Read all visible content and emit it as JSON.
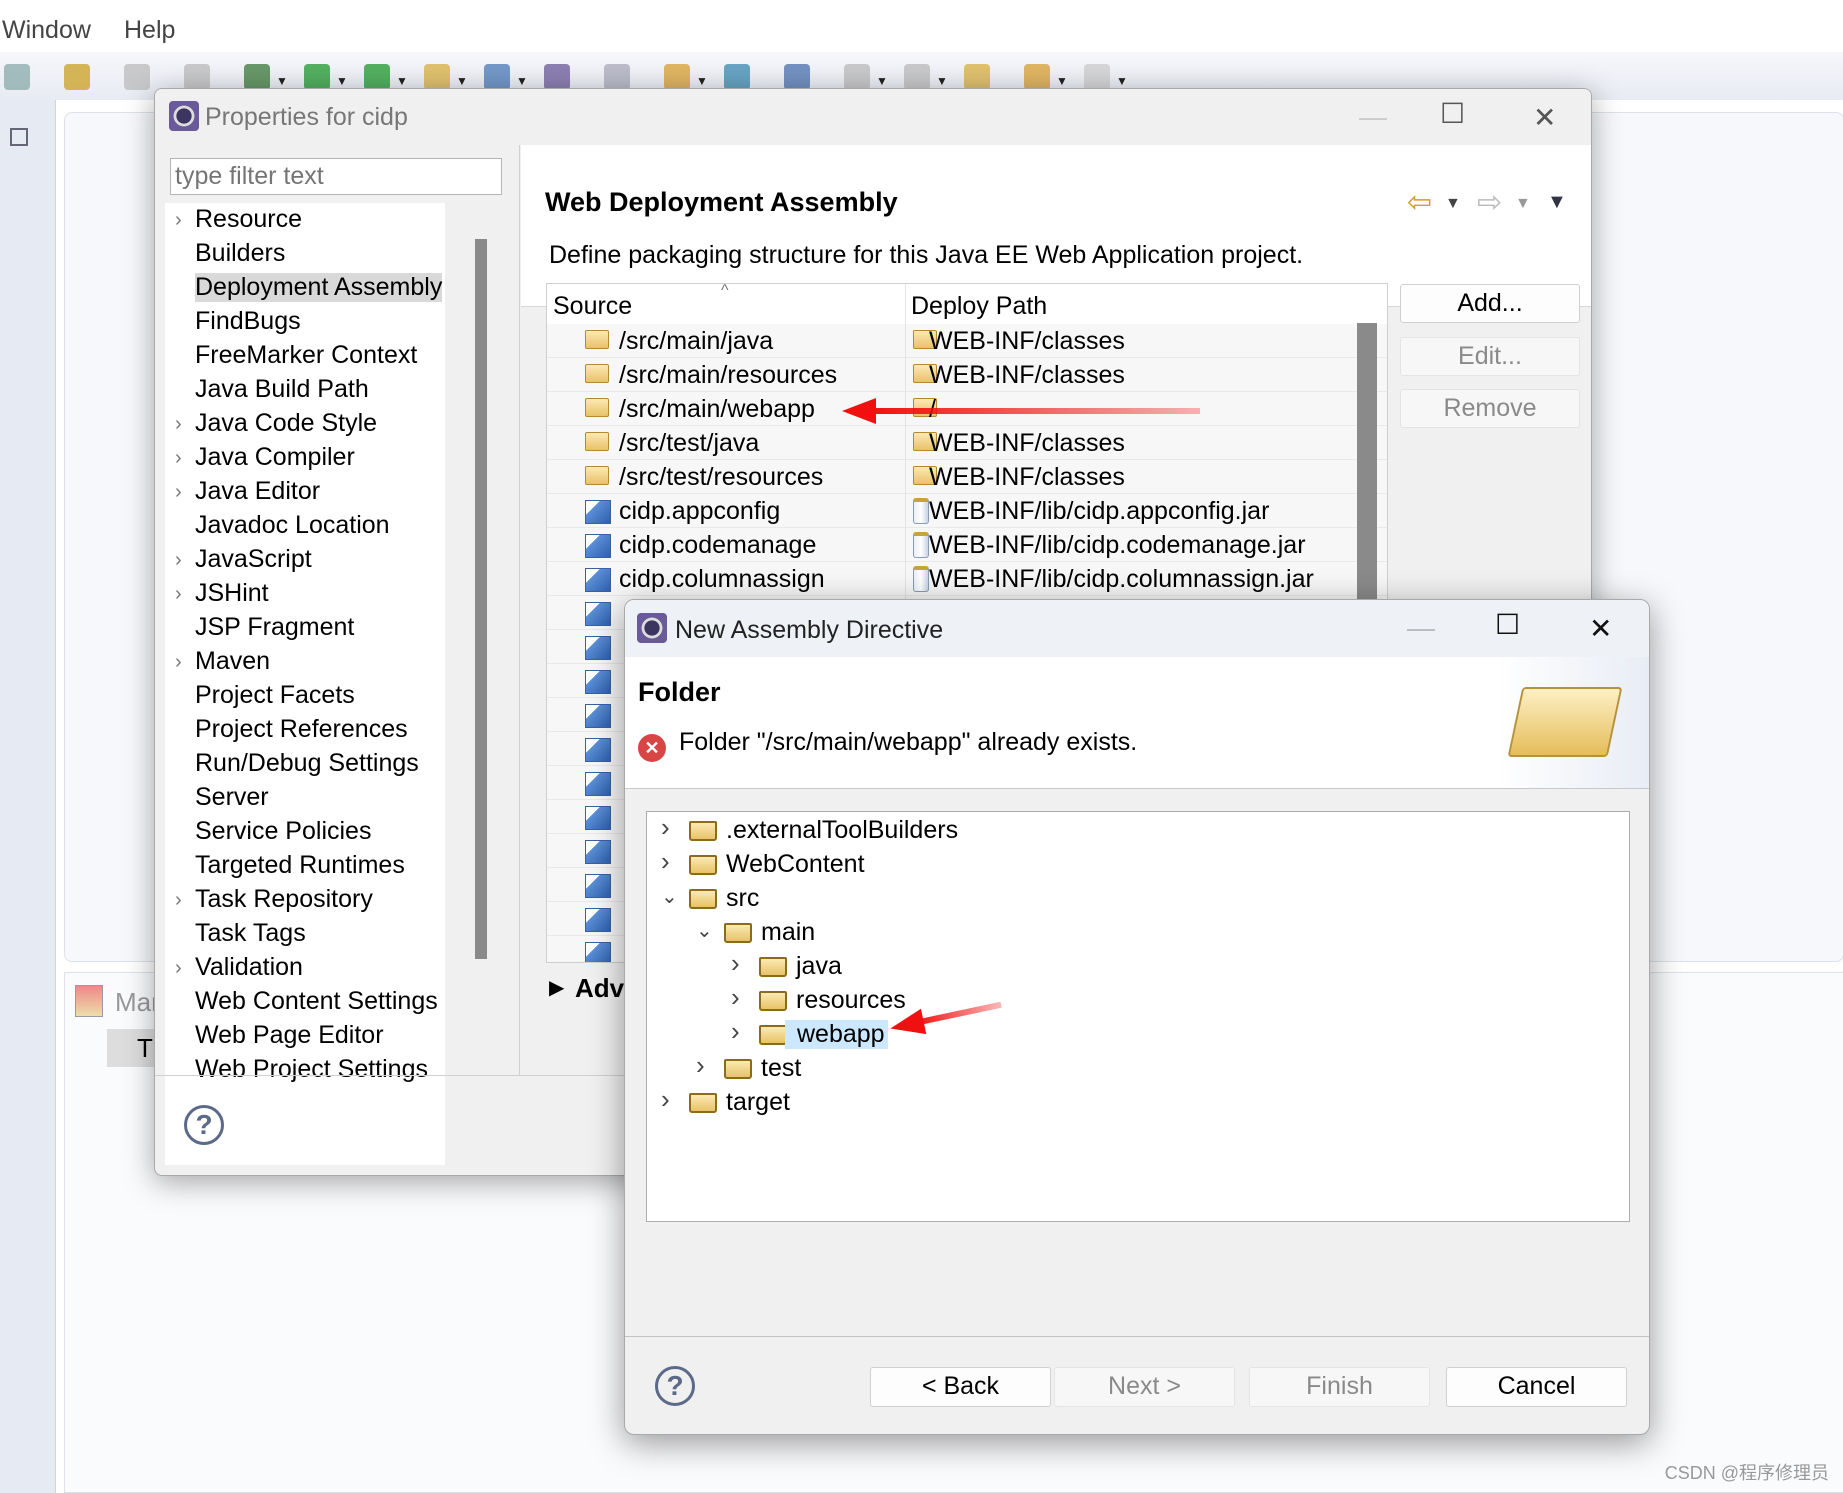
{
  "menubar": {
    "items": [
      "Window",
      "Help"
    ]
  },
  "workbench": {
    "panel_tab": "Mar",
    "panel_item": "T"
  },
  "properties": {
    "title": "Properties for cidp",
    "filter_placeholder": "type filter text",
    "nav": [
      {
        "label": "Resource",
        "expandable": true
      },
      {
        "label": "Builders",
        "expandable": false
      },
      {
        "label": "Deployment Assembly",
        "expandable": false,
        "selected": true
      },
      {
        "label": "FindBugs",
        "expandable": false
      },
      {
        "label": "FreeMarker Context",
        "expandable": false
      },
      {
        "label": "Java Build Path",
        "expandable": false
      },
      {
        "label": "Java Code Style",
        "expandable": true
      },
      {
        "label": "Java Compiler",
        "expandable": true
      },
      {
        "label": "Java Editor",
        "expandable": true
      },
      {
        "label": "Javadoc Location",
        "expandable": false
      },
      {
        "label": "JavaScript",
        "expandable": true
      },
      {
        "label": "JSHint",
        "expandable": true
      },
      {
        "label": "JSP Fragment",
        "expandable": false
      },
      {
        "label": "Maven",
        "expandable": true
      },
      {
        "label": "Project Facets",
        "expandable": false
      },
      {
        "label": "Project References",
        "expandable": false
      },
      {
        "label": "Run/Debug Settings",
        "expandable": false
      },
      {
        "label": "Server",
        "expandable": false
      },
      {
        "label": "Service Policies",
        "expandable": false
      },
      {
        "label": "Targeted Runtimes",
        "expandable": false
      },
      {
        "label": "Task Repository",
        "expandable": true
      },
      {
        "label": "Task Tags",
        "expandable": false
      },
      {
        "label": "Validation",
        "expandable": true
      },
      {
        "label": "Web Content Settings",
        "expandable": false
      },
      {
        "label": "Web Page Editor",
        "expandable": false
      },
      {
        "label": "Web Project Settings",
        "expandable": false
      }
    ],
    "page_title": "Web Deployment Assembly",
    "description": "Define packaging structure for this Java EE Web Application project.",
    "columns": [
      "Source",
      "Deploy Path"
    ],
    "rows": [
      {
        "source": "/src/main/java",
        "deploy": "WEB-INF/classes",
        "kind": "folder"
      },
      {
        "source": "/src/main/resources",
        "deploy": "WEB-INF/classes",
        "kind": "folder"
      },
      {
        "source": "/src/main/webapp",
        "deploy": "/",
        "kind": "folder"
      },
      {
        "source": "/src/test/java",
        "deploy": "WEB-INF/classes",
        "kind": "folder"
      },
      {
        "source": "/src/test/resources",
        "deploy": "WEB-INF/classes",
        "kind": "folder"
      },
      {
        "source": "cidp.appconfig",
        "deploy": "WEB-INF/lib/cidp.appconfig.jar",
        "kind": "project"
      },
      {
        "source": "cidp.codemanage",
        "deploy": "WEB-INF/lib/cidp.codemanage.jar",
        "kind": "project"
      },
      {
        "source": "cidp.columnassign",
        "deploy": "WEB-INF/lib/cidp.columnassign.jar",
        "kind": "project"
      },
      {
        "kind": "project"
      },
      {
        "kind": "project"
      },
      {
        "kind": "project"
      },
      {
        "kind": "project"
      },
      {
        "kind": "project"
      },
      {
        "kind": "project"
      },
      {
        "kind": "project"
      },
      {
        "kind": "project"
      },
      {
        "kind": "project"
      },
      {
        "kind": "project"
      },
      {
        "kind": "project"
      }
    ],
    "buttons": {
      "add": "Add...",
      "edit": "Edit...",
      "remove": "Remove"
    },
    "advanced": "Adv"
  },
  "dialog": {
    "title": "New Assembly Directive",
    "heading": "Folder",
    "error": "Folder \"/src/main/webapp\" already exists.",
    "tree": [
      {
        "label": ".externalToolBuilders",
        "depth": 0,
        "state": "collapsed"
      },
      {
        "label": "WebContent",
        "depth": 0,
        "state": "collapsed"
      },
      {
        "label": "src",
        "depth": 0,
        "state": "expanded"
      },
      {
        "label": "main",
        "depth": 1,
        "state": "expanded"
      },
      {
        "label": "java",
        "depth": 2,
        "state": "collapsed"
      },
      {
        "label": "resources",
        "depth": 2,
        "state": "collapsed"
      },
      {
        "label": "webapp",
        "depth": 2,
        "state": "collapsed",
        "selected": true
      },
      {
        "label": "test",
        "depth": 1,
        "state": "collapsed"
      },
      {
        "label": "target",
        "depth": 0,
        "state": "collapsed"
      }
    ],
    "buttons": {
      "back": "< Back",
      "next": "Next >",
      "finish": "Finish",
      "cancel": "Cancel"
    }
  },
  "annotation_color": "#f01010",
  "watermark": "CSDN @程序修理员"
}
